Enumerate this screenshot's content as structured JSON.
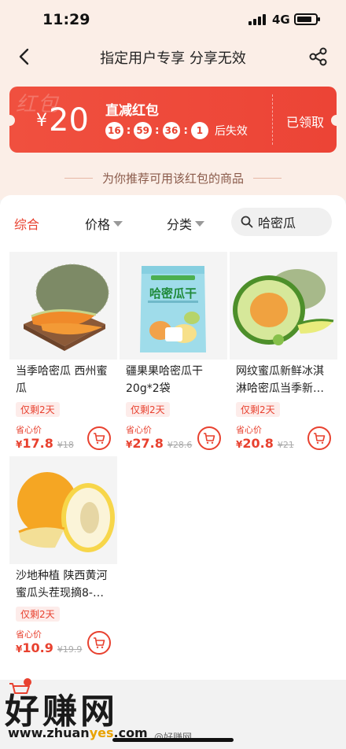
{
  "status_bar": {
    "time": "11:29",
    "network": "4G",
    "battery_level": 0.85
  },
  "nav": {
    "title": "指定用户专享 分享无效",
    "back_icon": "chevron-left-icon",
    "share_icon": "share-icon"
  },
  "coupon": {
    "bg_text": "红包",
    "currency": "¥",
    "amount": "20",
    "title": "直减红包",
    "countdown": [
      "16",
      "59",
      "36",
      "1"
    ],
    "countdown_suffix": "后失效",
    "status": "已领取"
  },
  "recommend_header": "为你推荐可用该红包的商品",
  "filters": {
    "items": [
      {
        "label": "综合"
      },
      {
        "label": "价格"
      },
      {
        "label": "分类"
      }
    ],
    "search_value": "哈密瓜"
  },
  "products": [
    {
      "title": "当季哈密瓜 西州蜜瓜",
      "tag": "仅剩2天",
      "price_label": "省心价",
      "currency": "¥",
      "price": "17.8",
      "original_price": "¥18"
    },
    {
      "title": "疆果果哈密瓜干20g*2袋",
      "tag": "仅剩2天",
      "price_label": "省心价",
      "currency": "¥",
      "price": "27.8",
      "original_price": "¥28.6",
      "package_text": "哈密瓜干"
    },
    {
      "title": "网纹蜜瓜新鲜冰淇淋哈密瓜当季新…",
      "tag": "仅剩2天",
      "price_label": "省心价",
      "currency": "¥",
      "price": "20.8",
      "original_price": "¥21"
    },
    {
      "title": "沙地种植 陕西黄河蜜瓜头茬现摘8-…",
      "tag": "仅剩2天",
      "price_label": "省心价",
      "currency": "¥",
      "price": "10.9",
      "original_price": "¥19.9"
    }
  ],
  "watermark": {
    "brand": "好赚网",
    "url_prefix": "www.zhuan",
    "url_highlight": "yes",
    "url_suffix": ".com",
    "weibo": "@好赚网"
  },
  "colors": {
    "accent": "#e8412f",
    "coupon_bg": "#ec4436",
    "page_top": "#fbeee7"
  }
}
